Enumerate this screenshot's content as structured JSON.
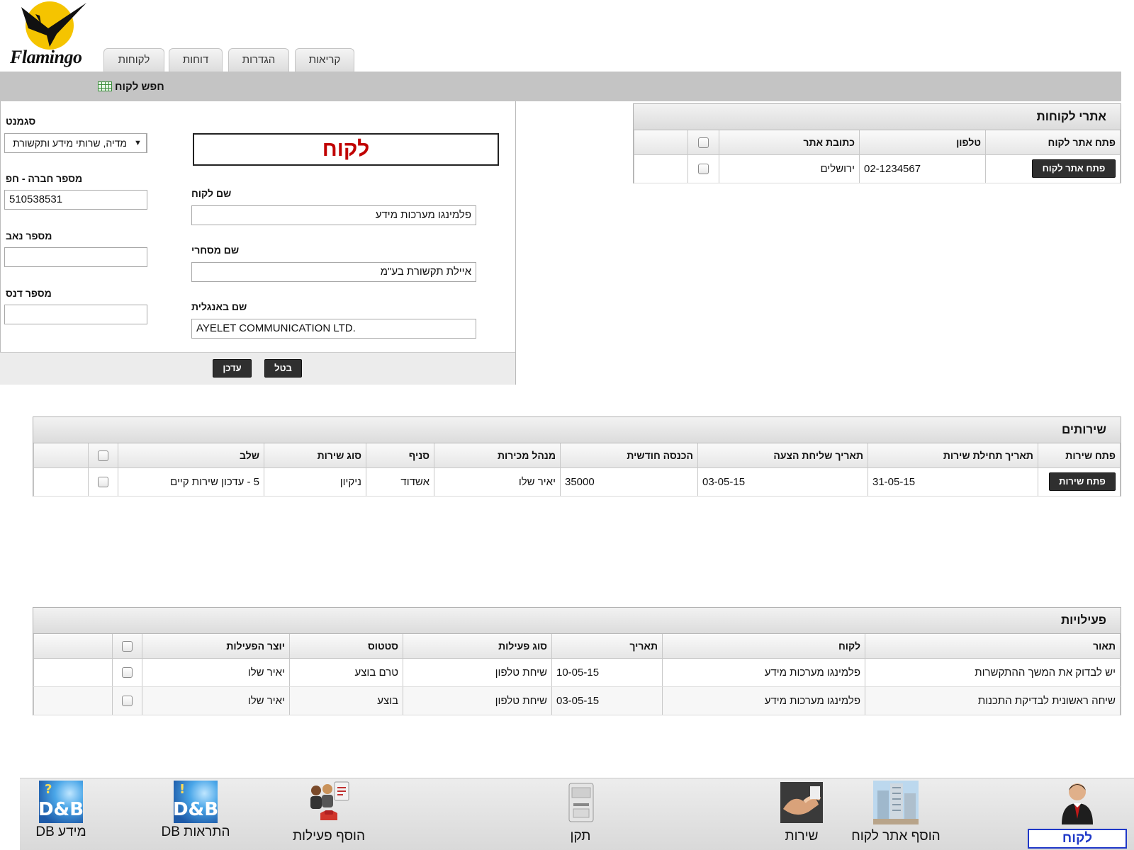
{
  "logo": {
    "text": "Flamingo"
  },
  "tabs": [
    {
      "label": "לקוחות"
    },
    {
      "label": "דוחות"
    },
    {
      "label": "הגדרות"
    },
    {
      "label": "קריאות"
    }
  ],
  "search_link": "חפש לקוח",
  "form": {
    "title": "לקוח",
    "segment_label": "סגמנט",
    "segment_value": "מדיה, שרותי מידע ותקשורת",
    "company_number_label": "מספר חברה - חפ",
    "company_number_value": "510538531",
    "nav_number_label": "מספר נאב",
    "nav_number_value": "",
    "duns_number_label": "מספר דנס",
    "duns_number_value": "",
    "customer_name_label": "שם לקוח",
    "customer_name_value": "פלמינגו מערכות מידע",
    "trade_name_label": "שם מסחרי",
    "trade_name_value": "איילת תקשורת בע\"מ",
    "english_name_label": "שם באנגלית",
    "english_name_value": "AYELET COMMUNICATION LTD.",
    "update_button": "עדכן",
    "cancel_button": "בטל"
  },
  "sites": {
    "title": "אתרי לקוחות",
    "headers": [
      "פתח אתר לקוח",
      "טלפון",
      "כתובת אתר"
    ],
    "rows": [
      {
        "button": "פתח אתר לקוח",
        "phone": "02-1234567",
        "address": "ירושלים"
      }
    ]
  },
  "services": {
    "title": "שירותים",
    "headers": [
      "פתח שירות",
      "תאריך תחילת שירות",
      "תאריך שליחת הצעה",
      "הכנסה חודשית",
      "מנהל מכירות",
      "סניף",
      "סוג שירות",
      "שלב"
    ],
    "rows": [
      {
        "button": "פתח שירות",
        "start_date": "31-05-15",
        "offer_date": "03-05-15",
        "monthly_income": "35000",
        "sales_manager": "יאיר שלו",
        "branch": "אשדוד",
        "service_type": "ניקיון",
        "stage": "5 - עדכון שירות קיים"
      }
    ]
  },
  "activities": {
    "title": "פעילויות",
    "headers": [
      "תאור",
      "לקוח",
      "תאריך",
      "סוג פעילות",
      "סטטוס",
      "יוצר הפעילות"
    ],
    "rows": [
      {
        "description": "יש לבדוק את המשך ההתקשרות",
        "customer": "פלמינגו מערכות מידע",
        "date": "10-05-15",
        "type": "שיחת טלפון",
        "status": "טרם בוצע",
        "creator": "יאיר שלו"
      },
      {
        "description": "שיחה ראשונית לבדיקת התכנות",
        "customer": "פלמינגו מערכות מידע",
        "date": "03-05-15",
        "type": "שיחת טלפון",
        "status": "בוצע",
        "creator": "יאיר שלו"
      }
    ]
  },
  "toolbar": {
    "items": [
      {
        "label": "מידע DB",
        "icon": "dnb-info-icon"
      },
      {
        "label": "התראות DB",
        "icon": "dnb-alerts-icon"
      },
      {
        "label": "הוסף פעילות",
        "icon": "add-activity-icon"
      },
      {
        "label": "תקן",
        "icon": "fix-icon"
      },
      {
        "label": "שירות",
        "icon": "service-icon"
      },
      {
        "label": "הוסף אתר לקוח",
        "icon": "add-site-icon"
      },
      {
        "label": "לקוח",
        "icon": "customer-icon"
      }
    ],
    "dnb_text": "D&B"
  }
}
